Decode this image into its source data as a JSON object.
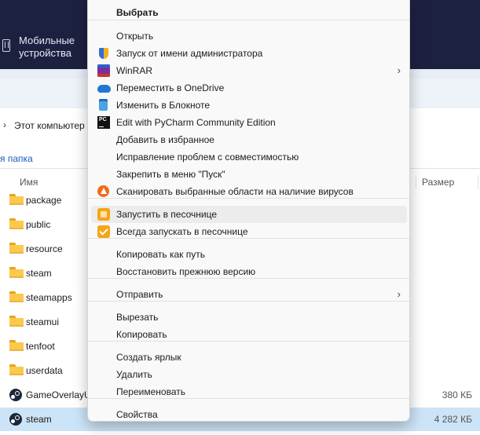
{
  "explorer": {
    "device_label": "Мобильные устройства",
    "breadcrumb": "Этот компьютер",
    "group_label": "я папка",
    "columns": {
      "name": "Имя",
      "size": "Размер"
    },
    "rows": [
      {
        "name": "package",
        "type": "folder",
        "size": ""
      },
      {
        "name": "public",
        "type": "folder",
        "size": ""
      },
      {
        "name": "resource",
        "type": "folder",
        "size": ""
      },
      {
        "name": "steam",
        "type": "folder",
        "size": ""
      },
      {
        "name": "steamapps",
        "type": "folder",
        "size": ""
      },
      {
        "name": "steamui",
        "type": "folder",
        "size": ""
      },
      {
        "name": "tenfoot",
        "type": "folder",
        "size": ""
      },
      {
        "name": "userdata",
        "type": "folder",
        "size": ""
      },
      {
        "name": "GameOverlayU",
        "type": "app",
        "size": "380 КБ"
      },
      {
        "name": "steam",
        "type": "app",
        "size": "4 282 КБ",
        "selected": true
      }
    ]
  },
  "context_menu": {
    "items": [
      {
        "label": "Выбрать",
        "bold": true,
        "icon": ""
      },
      {
        "label": "Открыть",
        "icon": ""
      },
      {
        "label": "Запуск от имени администратора",
        "icon": "uac-shield-icon"
      },
      {
        "label": "WinRAR",
        "icon": "winrar-icon",
        "submenu": true
      },
      {
        "label": "Переместить в OneDrive",
        "icon": "onedrive-icon"
      },
      {
        "label": "Изменить в Блокноте",
        "icon": "notepad-icon"
      },
      {
        "label": "Edit with PyCharm Community Edition",
        "icon": "pycharm-icon"
      },
      {
        "label": "Добавить в избранное",
        "icon": ""
      },
      {
        "label": "Исправление проблем с совместимостью",
        "icon": ""
      },
      {
        "label": "Закрепить в меню \"Пуск\"",
        "icon": ""
      },
      {
        "label": "Сканировать выбранные области на наличие вирусов",
        "icon": "antivirus-icon"
      },
      {
        "label": "Запустить в песочнице",
        "icon": "sandbox-icon",
        "highlighted": true
      },
      {
        "label": "Всегда запускать в песочнице",
        "icon": "sandbox-check-icon"
      },
      {
        "label": "Копировать как путь",
        "icon": ""
      },
      {
        "label": "Восстановить прежнюю версию",
        "icon": ""
      },
      {
        "label": "Отправить",
        "icon": "",
        "submenu": true
      },
      {
        "label": "Вырезать",
        "icon": ""
      },
      {
        "label": "Копировать",
        "icon": ""
      },
      {
        "label": "Создать ярлык",
        "icon": ""
      },
      {
        "label": "Удалить",
        "icon": ""
      },
      {
        "label": "Переименовать",
        "icon": ""
      },
      {
        "label": "Свойства",
        "icon": ""
      }
    ],
    "submenu_arrow": "›",
    "pycharm_glyph": "PC"
  }
}
